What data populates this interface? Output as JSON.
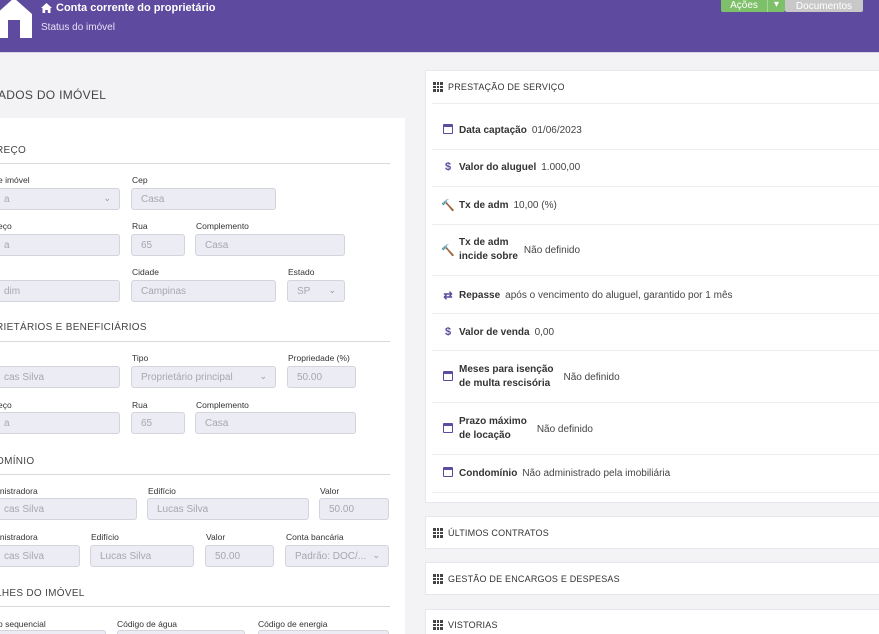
{
  "header": {
    "link_label": "Conta corrente do proprietário",
    "subtitle": "Status do imóvel",
    "acoes_label": "Ações",
    "documentos_label": "Documentos",
    "brand_color": "#5e4a9e"
  },
  "left": {
    "title": "ADOS DO IMÓVEL",
    "sections": {
      "endereco": "REÇO",
      "proprietarios": "RIETÁRIOS E BENEFICIÁRIOS",
      "condominio": "OMÍNIO",
      "detalhes": "LHES DO IMÓVEL"
    },
    "fields": {
      "tipo_imovel_label": "e imóvel",
      "tipo_imovel_value": "a",
      "cep_label": "Cep",
      "cep_value": "Casa",
      "endereco_label": "eço",
      "endereco_value": "a",
      "rua_label": "Rua",
      "rua_value": "65",
      "complemento_label": "Complemento",
      "complemento_value": "Casa",
      "bairro_value": "dim",
      "cidade_label": "Cidade",
      "cidade_value": "Campinas",
      "estado_label": "Estado",
      "estado_value": "SP",
      "prop_nome_value": "cas Silva",
      "tipo_label": "Tipo",
      "tipo_value": "Proprietário principal",
      "propriedade_label": "Propriedade (%)",
      "propriedade_value": "50.00",
      "prop_endereco_label": "eço",
      "prop_endereco_value": "a",
      "prop_rua_label": "Rua",
      "prop_rua_value": "65",
      "prop_complemento_label": "Complemento",
      "prop_complemento_value": "Casa",
      "administradora_label": "inistradora",
      "administradora_value": "cas Silva",
      "edificio_label": "Edifício",
      "edificio_value": "Lucas Silva",
      "valor_label": "Valor",
      "valor_value": "50.00",
      "administradora2_label": "inistradora",
      "administradora2_value": "cas Silva",
      "edificio2_label": "Edifício",
      "edificio2_value": "Lucas Silva",
      "valor2_label": "Valor",
      "valor2_value": "50.00",
      "conta_label": "Conta bancária",
      "conta_value": "Padrão: DOC/...",
      "sequencial_label": "o sequencial",
      "agua_label": "Código de água",
      "energia_label": "Código de energia"
    }
  },
  "right": {
    "prestacao_title": "PRESTAÇÃO DE SERVIÇO",
    "rows": [
      {
        "label": "Data captação",
        "value": "01/06/2023",
        "icon": "calendar-icon"
      },
      {
        "label": "Valor do aluguel",
        "value": "1.000,00",
        "icon": "dollar-icon"
      },
      {
        "label": "Tx de adm",
        "value": "10,00 (%)",
        "icon": "gavel-icon"
      },
      {
        "label_line1": "Tx de adm",
        "label_line2": "incide sobre",
        "value": "Não definido",
        "icon": "gavel-icon"
      },
      {
        "label": "Repasse",
        "value": "após o vencimento do aluguel, garantido por 1 mês",
        "icon": "exchange-icon"
      },
      {
        "label": "Valor de venda",
        "value": "0,00",
        "icon": "dollar-icon"
      },
      {
        "label_line1": "Meses para isenção",
        "label_line2": "de multa rescisória",
        "value": "Não definido",
        "icon": "calendar-icon"
      },
      {
        "label_line1": "Prazo máximo",
        "label_line2": "de locação",
        "value": "Não definido",
        "icon": "calendar-icon"
      },
      {
        "label": "Condomínio",
        "value": "Não administrado pela imobiliária",
        "icon": "calendar-icon"
      }
    ],
    "ultimos_contratos": "ÚLTIMOS CONTRATOS",
    "encargos": "GESTÃO DE ENCARGOS E DESPESAS",
    "vistorias": "VISTORIAS"
  }
}
